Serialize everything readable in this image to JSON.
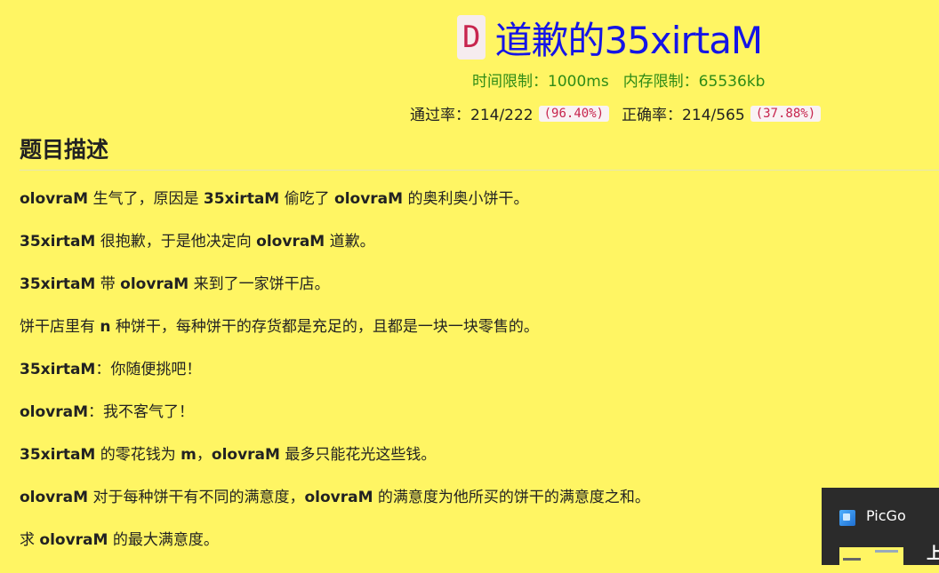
{
  "problem": {
    "id": "D",
    "title": "道歉的35xirtaM",
    "time_limit": "时间限制：1000ms",
    "memory_limit": "内存限制：65536kb",
    "pass_label": "通过率：214/222",
    "pass_pct": "(96.40%)",
    "correct_label": "正确率：214/565",
    "correct_pct": "(37.88%)"
  },
  "section_title": "题目描述",
  "description": [
    {
      "a": "olovraM",
      "b": " 生气了，原因是 ",
      "c": "35xirtaM",
      "d": " 偷吃了 ",
      "e": "olovraM",
      "f": " 的奥利奥小饼干。"
    },
    {
      "a": "35xirtaM",
      "b": " 很抱歉，于是他决定向 ",
      "c": "olovraM",
      "d": " 道歉。"
    },
    {
      "a": "35xirtaM",
      "b": " 带 ",
      "c": "olovraM",
      "d": " 来到了一家饼干店。"
    },
    {
      "a": "饼干店里有 ",
      "b": "n",
      "c": " 种饼干，每种饼干的存货都是充足的，且都是一块一块零售的。"
    },
    {
      "a": "35xirtaM",
      "b": "：你随便挑吧！"
    },
    {
      "a": "olovraM",
      "b": "：我不客气了！"
    },
    {
      "a": "35xirtaM",
      "b": " 的零花钱为 ",
      "c": "m",
      "d": "，",
      "e": "olovraM",
      "f": " 最多只能花光这些钱。"
    },
    {
      "a": "olovraM",
      "b": " 对于每种饼干有不同的满意度，",
      "c": "olovraM",
      "d": " 的满意度为他所买的饼干的满意度之和。"
    },
    {
      "a": "求 ",
      "b": "olovraM",
      "c": " 的最大满意度。"
    }
  ],
  "toast": {
    "app_name": "PicGo",
    "side_text": "上",
    "icon": "picgo-icon"
  },
  "colors": {
    "background": "#fff563",
    "title": "#1515e6",
    "limits": "#2e8b16",
    "code": "#c7254e"
  }
}
